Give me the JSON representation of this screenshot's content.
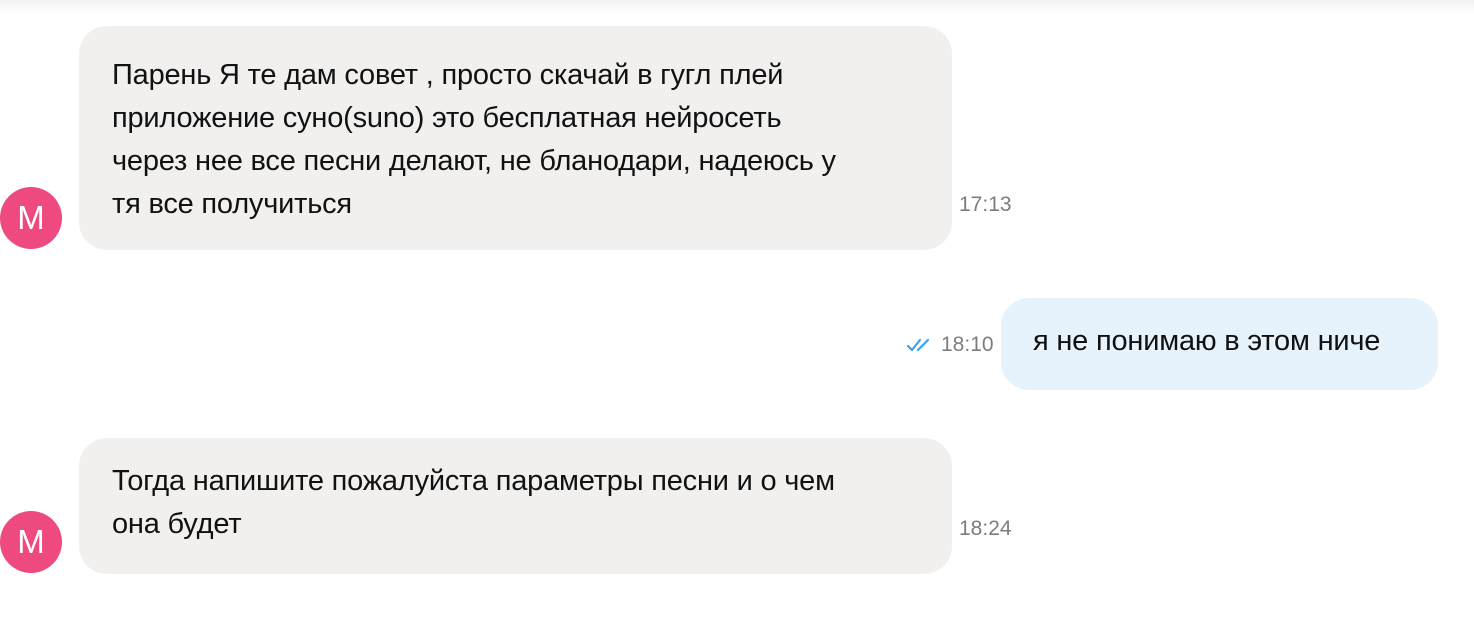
{
  "messages": [
    {
      "direction": "incoming",
      "avatar_letter": "M",
      "text": "Парень Я те дам совет , просто скачай в гугл плей\nприложение суно(suno) это бесплатная нейросеть\nчерез нее все песни делают, не бланодари, надеюсь у\nтя все получиться",
      "time": "17:13"
    },
    {
      "direction": "outgoing",
      "text": "я не понимаю в этом ниче",
      "time": "18:10",
      "status_icon": "double-check-icon",
      "status_color": "#3aa0f0"
    },
    {
      "direction": "incoming",
      "avatar_letter": "M",
      "text": "Тогда напишите пожалуйста параметры песни и о чем\nона будет",
      "time": "18:24"
    }
  ],
  "colors": {
    "avatar": "#ee4a7f",
    "incoming_bubble": "#f1f0ef",
    "outgoing_bubble": "#e6f3fc",
    "timestamp": "#7d7d7d",
    "read_check": "#3aa0f0"
  }
}
